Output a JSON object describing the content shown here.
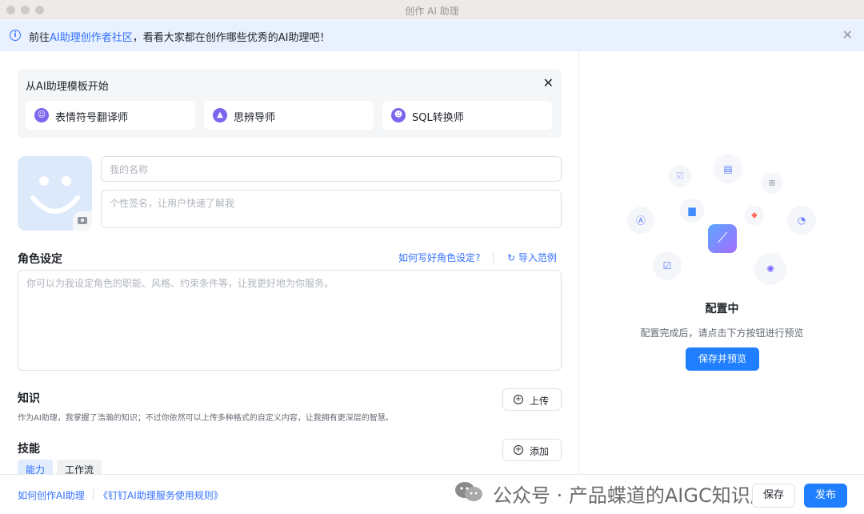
{
  "window": {
    "title": "创作 AI 助理"
  },
  "notice": {
    "prefix": "前往",
    "link": "AI助理创作者社区",
    "suffix": "，看看大家都在创作哪些优秀的AI助理吧！"
  },
  "templates": {
    "title": "从AI助理模板开始",
    "items": [
      {
        "label": "表情符号翻译师",
        "icon": "emoji-translator-icon"
      },
      {
        "label": "思辨导师",
        "icon": "graduation-cap-icon"
      },
      {
        "label": "SQL转换师",
        "icon": "sql-converter-icon"
      }
    ]
  },
  "profile": {
    "name_placeholder": "我的名称",
    "bio_placeholder": "个性签名，让用户快速了解我"
  },
  "role": {
    "title": "角色设定",
    "help_link": "如何写好角色设定?",
    "import_link": "导入范例",
    "placeholder": "你可以为我设定角色的职能、风格、约束条件等，让我更好地为你服务。"
  },
  "knowledge": {
    "title": "知识",
    "desc": "作为AI助理，我掌握了浩瀚的知识；不过你依然可以上传多种格式的自定义内容，让我拥有更深层的智慧。",
    "upload_label": "上传"
  },
  "skills": {
    "title": "技能",
    "add_label": "添加",
    "tabs": [
      "能力",
      "工作流"
    ]
  },
  "footer": {
    "how_to_link": "如何创作AI助理",
    "rules_link": "《钉钉AI助理服务使用规则》",
    "save_label": "保存",
    "publish_label": "发布",
    "watermark": "公众号 · 产品蝶道的AIGC知识库"
  },
  "preview": {
    "title": "配置中",
    "desc": "配置完成后，请点击下方按钮进行预览",
    "button": "保存并预览"
  },
  "colors": {
    "accent": "#1f7fff",
    "link": "#3370ff",
    "notice_bg": "#e8f1fd",
    "avatar_bg": "#dce9fb"
  }
}
